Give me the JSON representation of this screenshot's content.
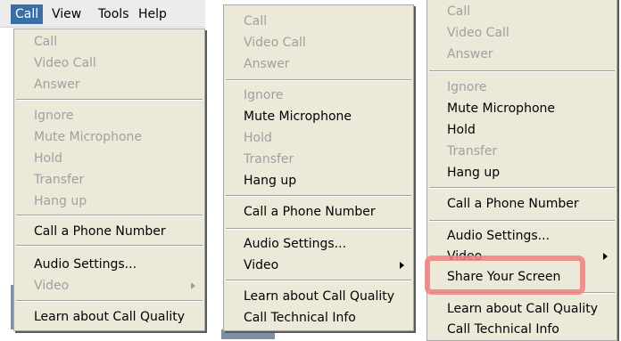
{
  "menubar": {
    "items": [
      "Call",
      "View",
      "Tools",
      "Help"
    ]
  },
  "menu1": {
    "items": [
      "Call",
      "Video Call",
      "Answer",
      "Ignore",
      "Mute Microphone",
      "Hold",
      "Transfer",
      "Hang up",
      "Call a Phone Number",
      "Audio Settings...",
      "Video",
      "Learn about Call Quality"
    ]
  },
  "menu2": {
    "items": [
      "Call",
      "Video Call",
      "Answer",
      "Ignore",
      "Mute Microphone",
      "Hold",
      "Transfer",
      "Hang up",
      "Call a Phone Number",
      "Audio Settings...",
      "Video",
      "Learn about Call Quality",
      "Call Technical Info"
    ]
  },
  "menu3": {
    "items": [
      "Call",
      "Video Call",
      "Answer",
      "Ignore",
      "Mute Microphone",
      "Hold",
      "Transfer",
      "Hang up",
      "Call a Phone Number",
      "Audio Settings...",
      "Video",
      "Share Your Screen",
      "Learn about Call Quality",
      "Call Technical Info"
    ]
  },
  "colors": {
    "menubar_active": "#3a6ea5",
    "highlight": "#f08080",
    "disabled_text": "#a0a0a0"
  },
  "icons": {
    "submenu_arrow": "chevron-right-icon"
  }
}
